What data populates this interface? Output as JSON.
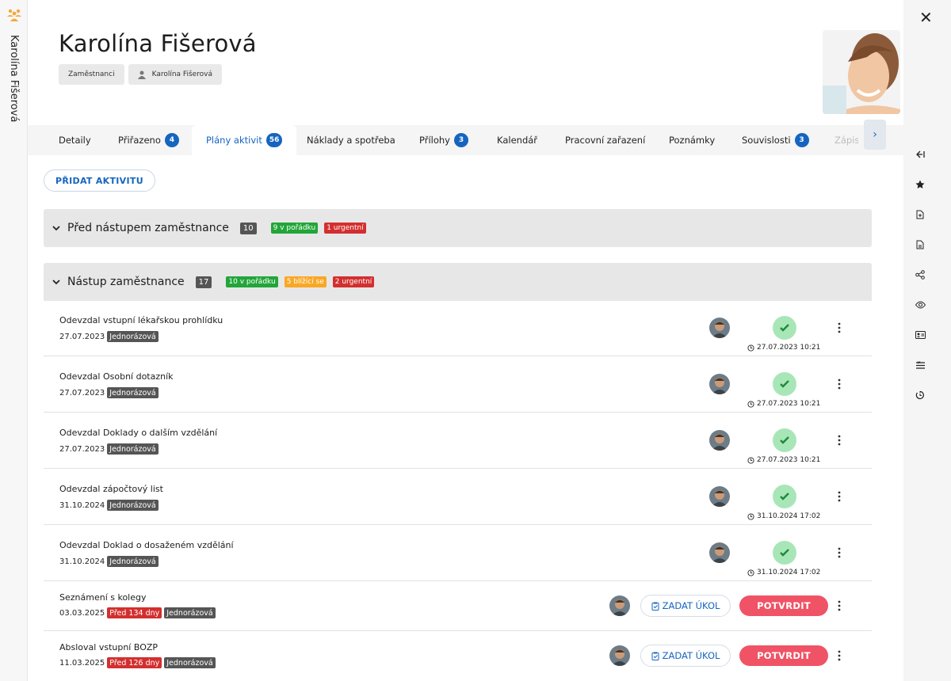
{
  "window": {
    "vertical_name": "Karolína Fišerová",
    "close_icon": "close-icon"
  },
  "header": {
    "title": "Karolína Fišerová",
    "breadcrumb": [
      {
        "label": "Zaměstnanci"
      },
      {
        "label": "Karolína Fišerová",
        "icon": "person-icon"
      }
    ]
  },
  "tabs": [
    {
      "label": "Detaily"
    },
    {
      "label": "Přiřazeno",
      "badge": "4"
    },
    {
      "label": "Plány aktivit",
      "badge": "56",
      "active": true
    },
    {
      "label": "Náklady a spotřeba"
    },
    {
      "label": "Přílohy",
      "badge": "3"
    },
    {
      "label": "Kalendář"
    },
    {
      "label": "Pracovní zařazení"
    },
    {
      "label": "Poznámky"
    },
    {
      "label": "Souvislosti",
      "badge": "3"
    },
    {
      "label": "Zápis"
    }
  ],
  "main": {
    "add_activity_label": "PŘIDAT AKTIVITU",
    "sections": [
      {
        "title": "Před nástupem zaměstnance",
        "count": "10",
        "statuses": [
          {
            "label": "9 v pořádku",
            "color": "#22a63a"
          },
          {
            "label": "1 urgentní",
            "color": "#d32f2f"
          }
        ]
      },
      {
        "title": "Nástup zaměstnance",
        "count": "17",
        "statuses": [
          {
            "label": "10 v pořádku",
            "color": "#22a63a"
          },
          {
            "label": "5 blížící se",
            "color": "#f9a825"
          },
          {
            "label": "2 urgentní",
            "color": "#d32f2f"
          }
        ]
      }
    ],
    "rows": [
      {
        "name": "Odevzdal vstupní lékařskou prohlídku",
        "date": "27.07.2023",
        "type": "Jednorázová",
        "done": "27.07.2023 10:21"
      },
      {
        "name": "Odevzdal Osobní dotazník",
        "date": "27.07.2023",
        "type": "Jednorázová",
        "done": "27.07.2023 10:21"
      },
      {
        "name": "Odevzdal Doklady o dalším vzdělání",
        "date": "27.07.2023",
        "type": "Jednorázová",
        "done": "27.07.2023 10:21"
      },
      {
        "name": "Odevzdal zápočtový list",
        "date": "31.10.2024",
        "type": "Jednorázová",
        "done": "31.10.2024 17:02"
      },
      {
        "name": "Odevzdal Doklad o dosaženém vzdělání",
        "date": "31.10.2024",
        "type": "Jednorázová",
        "done": "31.10.2024 17:02"
      },
      {
        "name": "Seznámení s kolegy",
        "date": "03.03.2025",
        "overdue": "Před 134 dny",
        "type": "Jednorázová",
        "task_label": "ZADAT ÚKOL",
        "confirm_label": "POTVRDIT"
      },
      {
        "name": "Absloval vstupní BOZP",
        "date": "11.03.2025",
        "overdue": "Před 126 dny",
        "type": "Jednorázová",
        "task_label": "ZADAT ÚKOL",
        "confirm_label": "POTVRDIT"
      }
    ]
  },
  "right_toolbar": [
    "collapse-left-icon",
    "star-icon",
    "document-add-icon",
    "document-icon",
    "share-icon",
    "eye-icon",
    "id-card-icon",
    "checklist-icon",
    "history-icon"
  ],
  "colors": {
    "accent": "#1565c0",
    "confirm": "#ef5365",
    "done_check": "#a8e6b8"
  }
}
